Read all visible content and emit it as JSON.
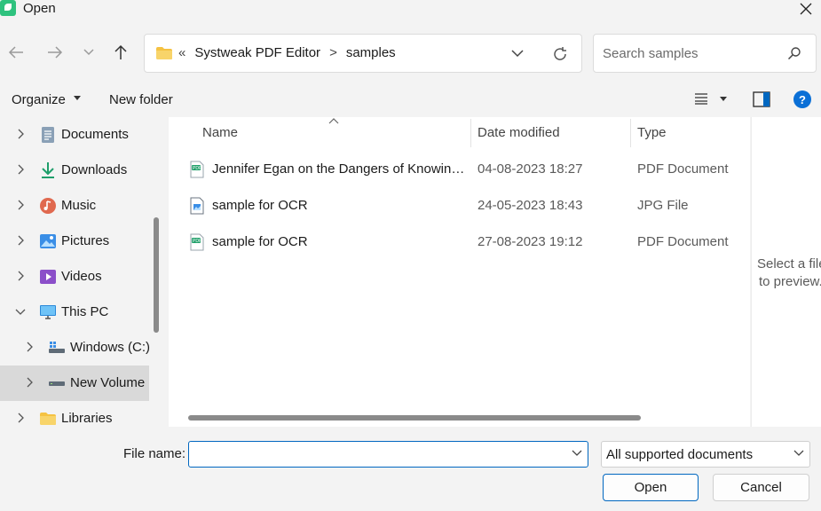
{
  "window": {
    "title": "Open"
  },
  "nav": {
    "path": [
      "Systweak PDF Editor",
      "samples"
    ],
    "path_prefix": "«",
    "path_sep": ">",
    "search_placeholder": "Search samples"
  },
  "toolbar": {
    "organize": "Organize",
    "new_folder": "New folder",
    "help": "?"
  },
  "sidebar": {
    "items": [
      {
        "label": "Documents",
        "icon": "documents-icon",
        "expanded": false
      },
      {
        "label": "Downloads",
        "icon": "download-icon",
        "expanded": false
      },
      {
        "label": "Music",
        "icon": "music-icon",
        "expanded": false
      },
      {
        "label": "Pictures",
        "icon": "pictures-icon",
        "expanded": false
      },
      {
        "label": "Videos",
        "icon": "videos-icon",
        "expanded": false
      },
      {
        "label": "This PC",
        "icon": "computer-icon",
        "expanded": true
      },
      {
        "label": "Windows (C:)",
        "icon": "drive-icon",
        "expanded": false
      },
      {
        "label": "New Volume",
        "icon": "drive-icon",
        "expanded": false,
        "selected": true
      },
      {
        "label": "Libraries",
        "icon": "folder-icon",
        "expanded": false
      }
    ]
  },
  "files": {
    "columns": [
      "Name",
      "Date modified",
      "Type"
    ],
    "rows": [
      {
        "name": "Jennifer Egan on the Dangers of Knowing...",
        "date": "04-08-2023 18:27",
        "type": "PDF Document",
        "icon": "pdf-file-icon"
      },
      {
        "name": "sample for OCR",
        "date": "24-05-2023 18:43",
        "type": "JPG File",
        "icon": "image-file-icon"
      },
      {
        "name": "sample for OCR",
        "date": "27-08-2023 19:12",
        "type": "PDF Document",
        "icon": "pdf-file-icon"
      }
    ]
  },
  "preview": {
    "line1": "Select a file",
    "line2": "to preview."
  },
  "footer": {
    "file_name_label": "File name:",
    "file_name_value": "",
    "file_type": "All supported documents",
    "open_label": "Open",
    "cancel_label": "Cancel"
  },
  "colors": {
    "accent": "#0067c0",
    "selected_bg": "#d9d9d9",
    "pdf_green": "#22a06b"
  }
}
